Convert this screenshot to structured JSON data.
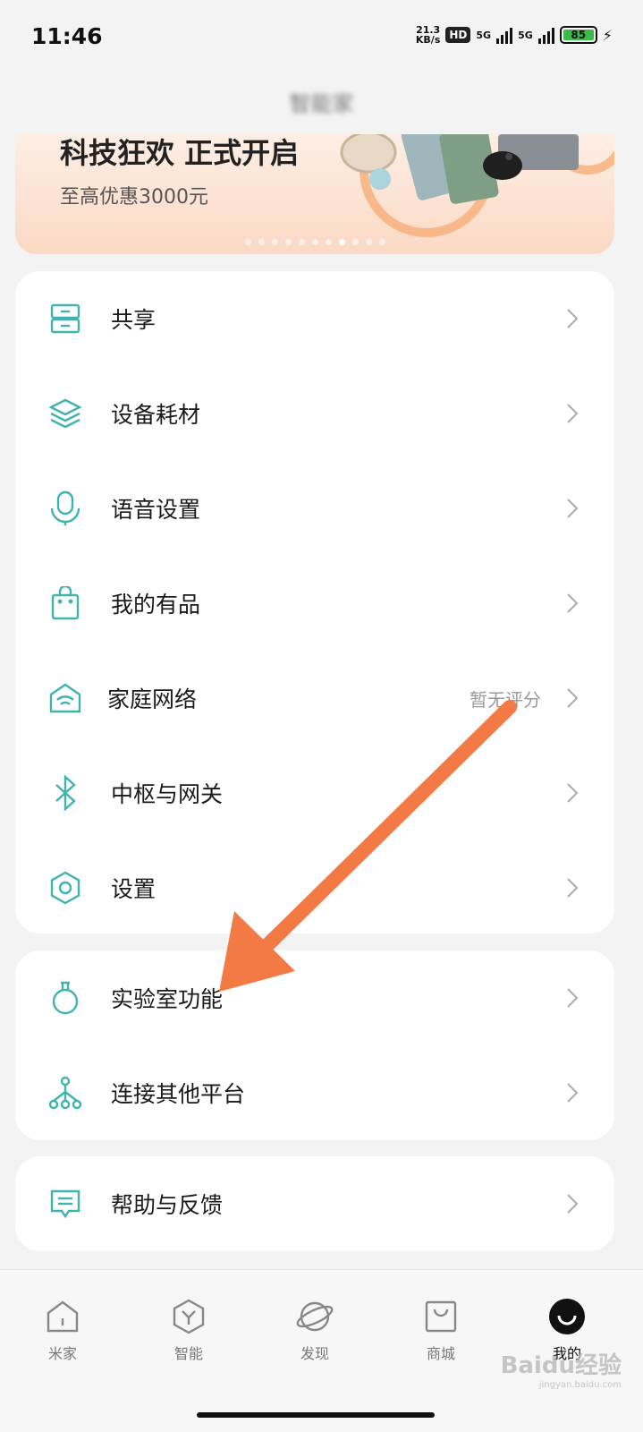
{
  "status_bar": {
    "time": "11:46",
    "net_speed": "21.3",
    "net_unit": "KB/s",
    "hd_badge": "HD",
    "sim1": "5G",
    "sim2": "5G",
    "battery": "85"
  },
  "header": {
    "title": "智能家"
  },
  "banner": {
    "headline": "科技狂欢 正式开启",
    "subtitle": "至高优惠3000元",
    "page_count": 11,
    "active_page": 7
  },
  "menu_group_1": [
    {
      "label": "共享",
      "icon": "share-icon"
    },
    {
      "label": "设备耗材",
      "icon": "layers-icon"
    },
    {
      "label": "语音设置",
      "icon": "microphone-icon"
    },
    {
      "label": "我的有品",
      "icon": "shopping-bag-icon"
    },
    {
      "label": "家庭网络",
      "icon": "home-wifi-icon",
      "extra": "暂无评分"
    },
    {
      "label": "中枢与网关",
      "icon": "bluetooth-icon"
    },
    {
      "label": "设置",
      "icon": "hexagon-settings-icon"
    }
  ],
  "menu_group_2": [
    {
      "label": "实验室功能",
      "icon": "flask-icon"
    },
    {
      "label": "连接其他平台",
      "icon": "network-nodes-icon"
    }
  ],
  "menu_group_3": [
    {
      "label": "帮助与反馈",
      "icon": "feedback-icon"
    }
  ],
  "tabbar": [
    {
      "label": "米家",
      "icon": "home-tab-icon",
      "active": false
    },
    {
      "label": "智能",
      "icon": "smart-tab-icon",
      "active": false
    },
    {
      "label": "发现",
      "icon": "planet-tab-icon",
      "active": false
    },
    {
      "label": "商城",
      "icon": "store-tab-icon",
      "active": false
    },
    {
      "label": "我的",
      "icon": "profile-tab-icon",
      "active": true
    }
  ],
  "watermark": {
    "text": "Baidu经验",
    "url": "jingyan.baidu.com"
  },
  "colors": {
    "accent": "#3fb3ad",
    "annotation_arrow": "#f47a45",
    "background": "#f3f3f3"
  }
}
